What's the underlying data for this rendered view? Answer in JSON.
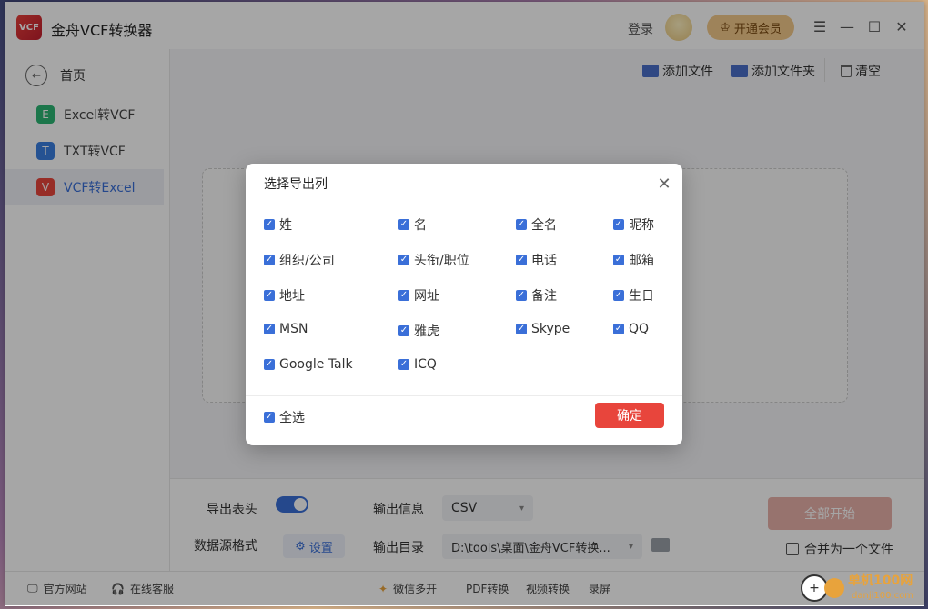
{
  "app": {
    "title": "金舟VCF转换器",
    "logo_text": "VCF",
    "login": "登录",
    "vip": "开通会员"
  },
  "sidebar": {
    "home": "首页",
    "items": [
      {
        "badge": "E",
        "label": "Excel转VCF",
        "color": "#2bb673"
      },
      {
        "badge": "T",
        "label": "TXT转VCF",
        "color": "#3a7fe0"
      },
      {
        "badge": "V",
        "label": "VCF转Excel",
        "color": "#e9453c"
      }
    ]
  },
  "toolbar": {
    "add_file": "添加文件",
    "add_folder": "添加文件夹",
    "clear": "清空"
  },
  "settings": {
    "export_header_label": "导出表头",
    "export_header_on": true,
    "source_format_label": "数据源格式",
    "set_button": "设置",
    "output_info_label": "输出信息",
    "output_info_value": "CSV",
    "output_dir_label": "输出目录",
    "output_dir_value": "D:\\tools\\桌面\\金舟VCF转换...",
    "start_button": "全部开始",
    "merge_label": "合并为一个文件"
  },
  "footer": {
    "site": "官方网站",
    "service": "在线客服",
    "links": [
      "微信多开",
      "PDF转换",
      "视频转换",
      "录屏"
    ]
  },
  "watermark": {
    "brand": "单机100网",
    "url": "danji100.com"
  },
  "modal": {
    "title": "选择导出列",
    "options": [
      "姓",
      "名",
      "全名",
      "昵称",
      "组织/公司",
      "头衔/职位",
      "电话",
      "邮箱",
      "地址",
      "网址",
      "备注",
      "生日",
      "MSN",
      "雅虎",
      "Skype",
      "QQ",
      "Google Talk",
      "ICQ"
    ],
    "select_all": "全选",
    "ok": "确定"
  }
}
